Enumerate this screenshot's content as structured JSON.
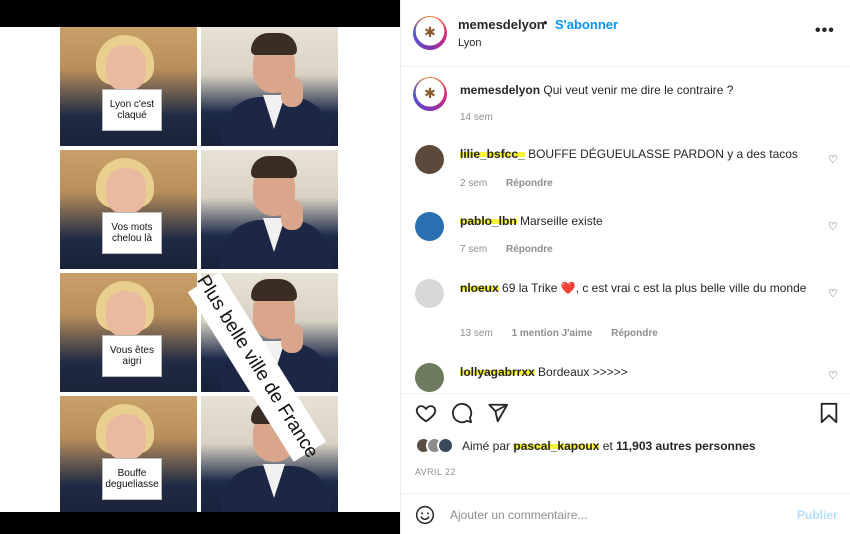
{
  "post": {
    "username": "memesdelyon",
    "follow_label": "S'abonner",
    "dot": "•",
    "location": "Lyon",
    "more_icon": "more-horizontal-icon"
  },
  "meme": {
    "signs": [
      "Lyon c'est claqué",
      "Vos mots chelou là",
      "Vous êtes aigri",
      "Bouffe degueliasse"
    ],
    "diagonal_text": "Plus belle ville de France"
  },
  "caption": {
    "username": "memesdelyon",
    "text": "Qui veut venir me dire le contraire ?",
    "time": "14 sem"
  },
  "comments": [
    {
      "username": "lilie_bsfcc_",
      "text": "BOUFFE DÉGUEULASSE PARDON y a des tacos",
      "time": "2 sem",
      "likes": "",
      "reply": "Répondre",
      "avatar_color": "#5b4a3c"
    },
    {
      "username": "pablo_lbn",
      "text": "Marseille existe",
      "time": "7 sem",
      "likes": "",
      "reply": "Répondre",
      "avatar_color": "#2a6fb0"
    },
    {
      "username": "nloeux",
      "text": "69 la Trike ❤️, c est vrai c est la plus belle ville du monde",
      "time": "13 sem",
      "likes": "1 mention J'aime",
      "reply": "Répondre",
      "avatar_color": "#d8d8d8"
    },
    {
      "username": "lollyagabrrxx",
      "text": "Bordeaux >>>>>",
      "time": "",
      "likes": "",
      "reply": "",
      "avatar_color": "#6d7a5e"
    }
  ],
  "actions": {
    "like_icon": "heart-icon",
    "comment_icon": "comment-icon",
    "share_icon": "send-icon",
    "save_icon": "bookmark-icon",
    "liked_prefix": "Aimé par",
    "liked_user": "pascal_kapoux",
    "liked_and": "et",
    "liked_count": "11,903 autres personnes",
    "date": "AVRIL 22"
  },
  "add_comment": {
    "placeholder": "Ajouter un commentaire...",
    "post_label": "Publier"
  }
}
